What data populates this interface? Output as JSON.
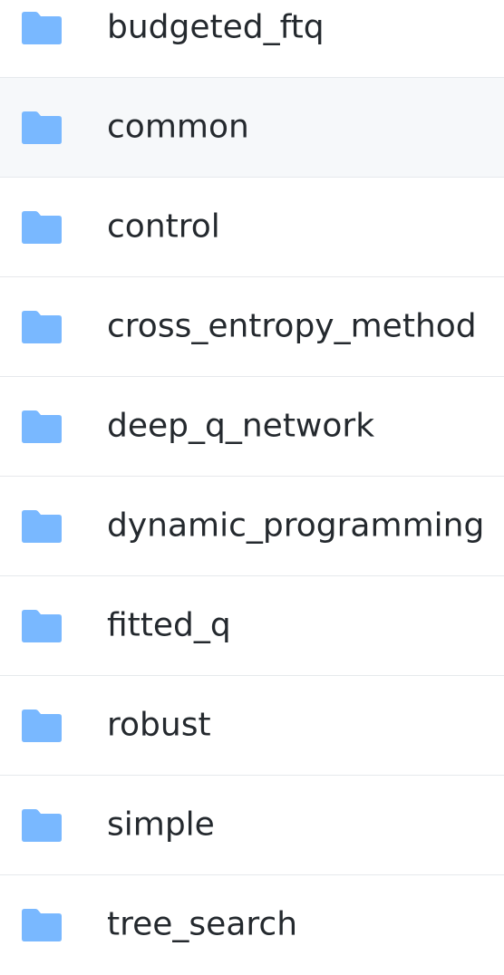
{
  "folder_icon": "folder-icon",
  "colors": {
    "folder": "#79b8ff",
    "text": "#24292e",
    "hover_row": "#f6f8fa",
    "divider": "#e6e9ec"
  },
  "items": [
    {
      "name": "budgeted_ftq",
      "type": "folder"
    },
    {
      "name": "common",
      "type": "folder"
    },
    {
      "name": "control",
      "type": "folder"
    },
    {
      "name": "cross_entropy_method",
      "type": "folder"
    },
    {
      "name": "deep_q_network",
      "type": "folder"
    },
    {
      "name": "dynamic_programming",
      "type": "folder"
    },
    {
      "name": "fitted_q",
      "type": "folder"
    },
    {
      "name": "robust",
      "type": "folder"
    },
    {
      "name": "simple",
      "type": "folder"
    },
    {
      "name": "tree_search",
      "type": "folder"
    }
  ]
}
